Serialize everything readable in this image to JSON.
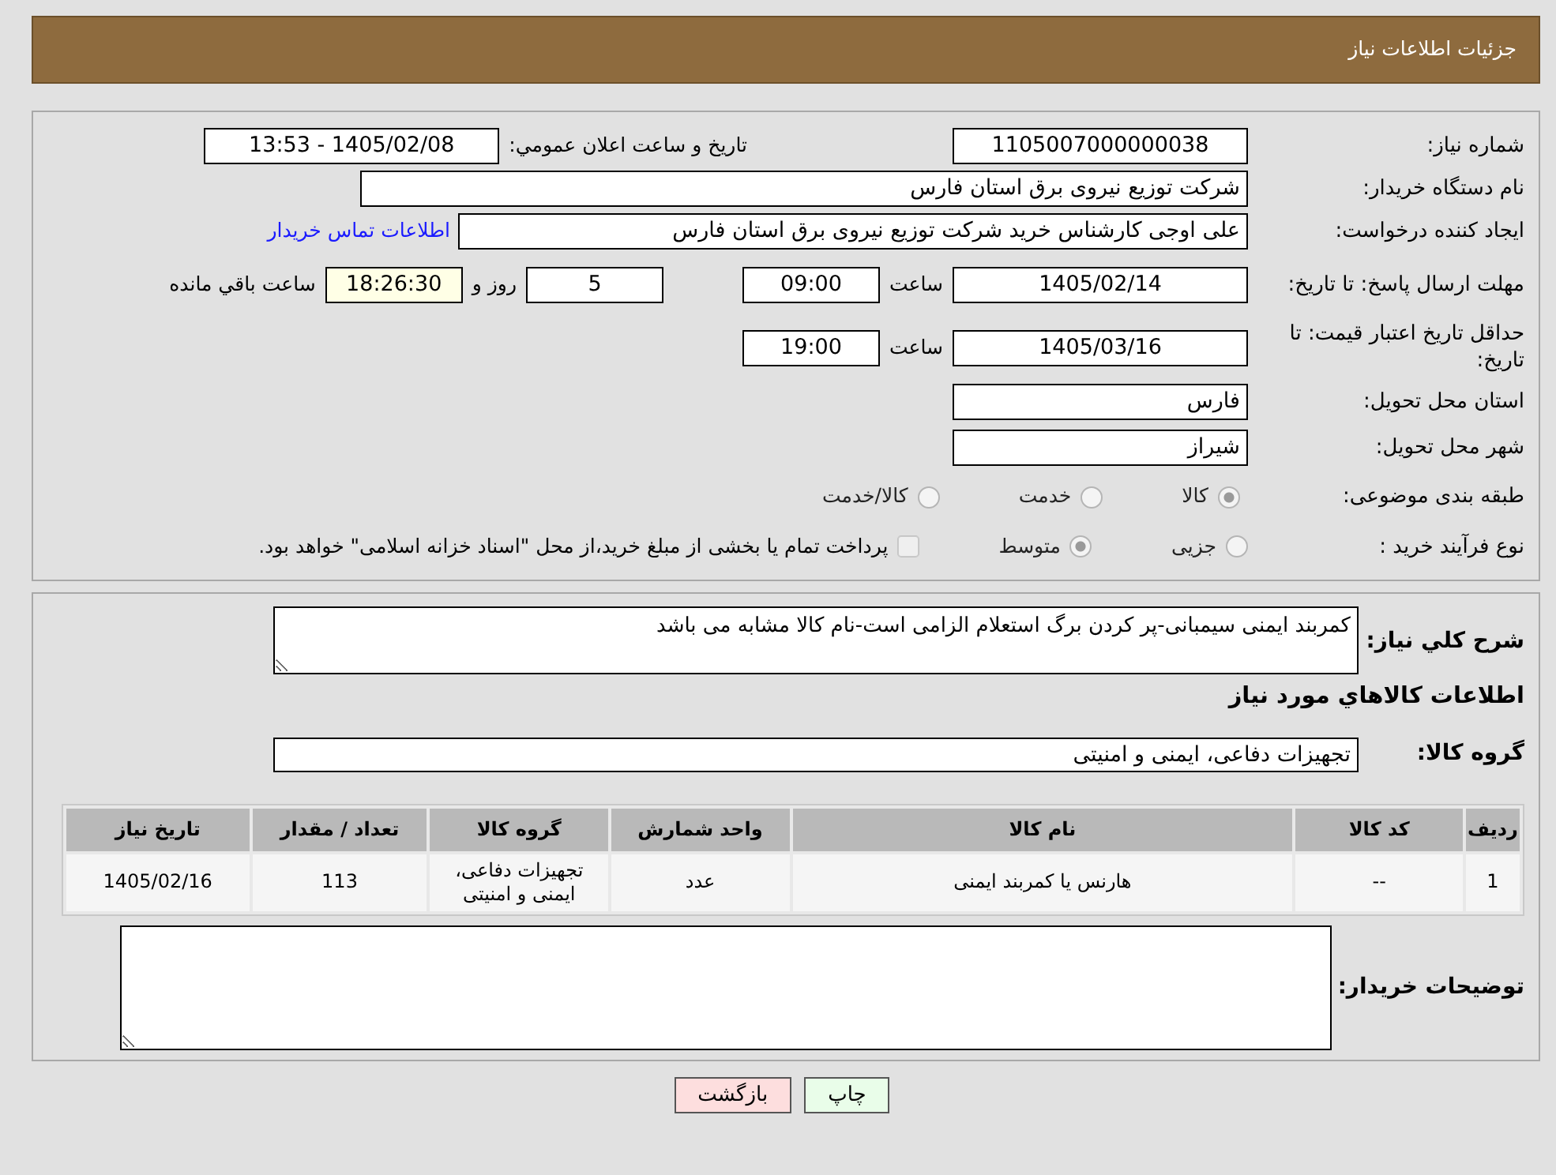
{
  "header": {
    "title": "جزئیات اطلاعات نیاز"
  },
  "need_number": {
    "label": "شماره نیاز:",
    "value": "1105007000000038"
  },
  "announcement": {
    "label": "تاريخ و ساعت اعلان عمومي:",
    "value": "1405/02/08 - 13:53"
  },
  "buyer_org": {
    "label": "نام دستگاه خریدار:",
    "value": "شرکت توزیع نیروی برق استان فارس"
  },
  "requester": {
    "label": "ایجاد کننده درخواست:",
    "value": "علی اوجی کارشناس خرید شرکت توزیع نیروی برق استان فارس",
    "link": "اطلاعات تماس خريدار"
  },
  "reply_deadline": {
    "label": "مهلت ارسال پاسخ: تا تاریخ:",
    "date": "1405/02/14",
    "time_label": "ساعت",
    "time": "09:00",
    "days": "5",
    "days_label": "روز و",
    "remaining": "18:26:30",
    "remaining_label": "ساعت باقي مانده"
  },
  "price_validity": {
    "label": "حداقل تاریخ اعتبار قیمت: تا تاریخ:",
    "date": "1405/03/16",
    "time_label": "ساعت",
    "time": "19:00"
  },
  "province": {
    "label": "استان محل تحویل:",
    "value": "فارس"
  },
  "city": {
    "label": "شهر محل تحویل:",
    "value": "شیراز"
  },
  "category": {
    "label": "طبقه بندی موضوعی:",
    "options": [
      {
        "label": "کالا",
        "selected": true
      },
      {
        "label": "خدمت",
        "selected": false
      },
      {
        "label": "کالا/خدمت",
        "selected": false
      }
    ]
  },
  "process": {
    "label": "نوع فرآیند خرید :",
    "options": [
      {
        "label": "جزیی",
        "selected": false
      },
      {
        "label": "متوسط",
        "selected": true
      }
    ],
    "payment": {
      "label": "پرداخت تمام یا بخشی از مبلغ خرید،از محل \"اسناد خزانه اسلامی\" خواهد بود.",
      "checked": false
    }
  },
  "description": {
    "label": "شرح کلي نياز:",
    "value": "کمربند ایمنی سیمبانی-پر کردن برگ استعلام الزامی است-نام کالا مشابه می باشد"
  },
  "goods_heading": "اطلاعات کالاهاي مورد نياز",
  "goods_group": {
    "label": "گروه کالا:",
    "value": "تجهیزات دفاعی، ایمنی و امنیتی"
  },
  "table": {
    "columns": [
      "ردیف",
      "کد کالا",
      "نام کالا",
      "واحد شمارش",
      "گروه کالا",
      "تعداد / مقدار",
      "تاریخ نیاز"
    ],
    "rows": [
      [
        "1",
        "--",
        "هارنس یا کمربند ایمنی",
        "عدد",
        "تجهیزات دفاعی، ایمنی و امنیتی",
        "113",
        "1405/02/16"
      ]
    ]
  },
  "buyer_notes": {
    "label": "توضیحات خریدار:"
  },
  "buttons": [
    {
      "label": "چاپ",
      "kind": "print"
    },
    {
      "label": "بازگشت",
      "kind": "back"
    }
  ]
}
